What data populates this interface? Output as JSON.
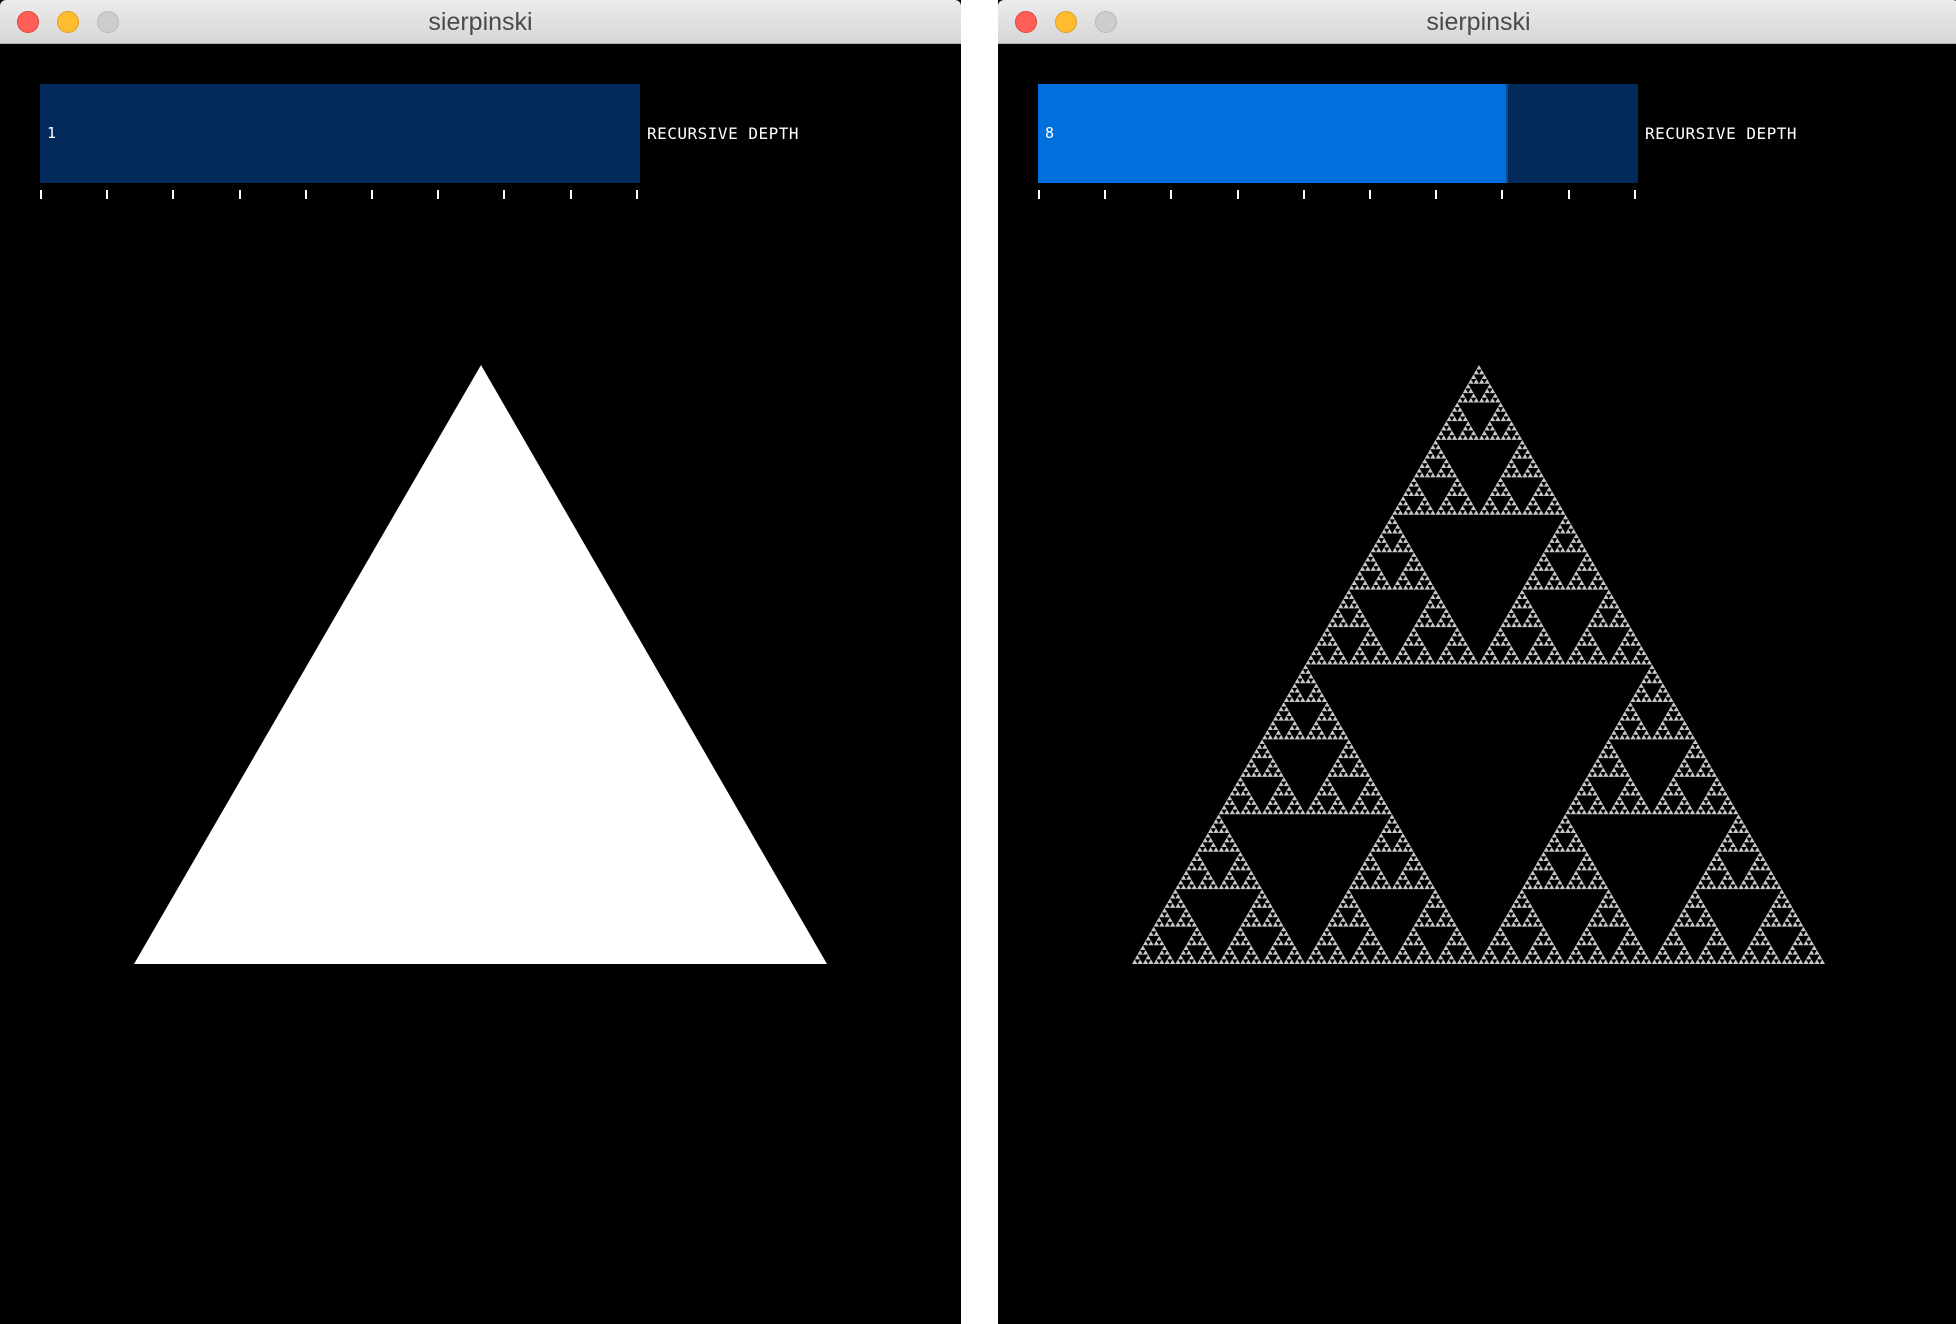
{
  "windows": [
    {
      "title": "sierpinski",
      "slider": {
        "value_text": "1",
        "label": "RECURSIVE DEPTH",
        "fraction": 0.0
      },
      "fractal": {
        "depth": 1,
        "color": "#ffffff"
      }
    },
    {
      "title": "sierpinski",
      "slider": {
        "value_text": "8",
        "label": "RECURSIVE DEPTH",
        "fraction": 0.78
      },
      "fractal": {
        "depth": 8,
        "color": "#c8c8c8"
      }
    }
  ],
  "colors": {
    "slider_track": "#012a5a",
    "slider_fill": "#0070de",
    "canvas_bg": "#000000"
  }
}
